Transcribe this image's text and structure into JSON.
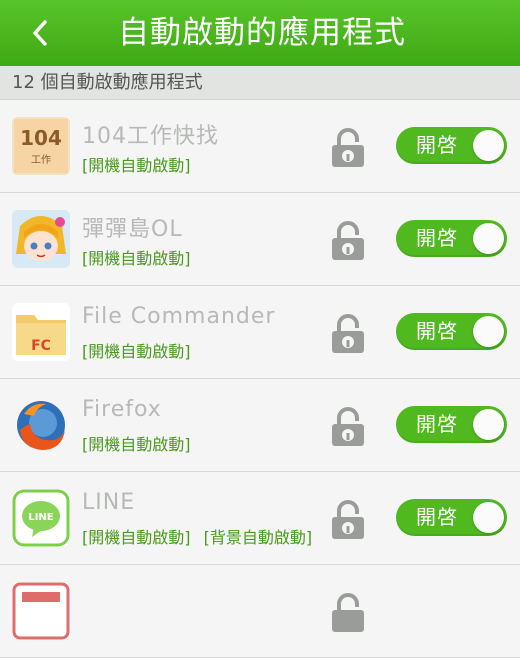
{
  "header": {
    "title": "自動啟動的應用程式",
    "back_icon": "chevron-left-icon"
  },
  "subheader": {
    "text": "12 個自動啟動應用程式"
  },
  "apps": [
    {
      "name": "104工作快找",
      "tags": [
        "[開機自動啟動]"
      ],
      "toggle": "開啓",
      "icon": "104-app-icon"
    },
    {
      "name": "彈彈島OL",
      "tags": [
        "[開機自動啟動]"
      ],
      "toggle": "開啓",
      "icon": "anime-game-icon"
    },
    {
      "name": "File Commander",
      "tags": [
        "[開機自動啟動]"
      ],
      "toggle": "開啓",
      "icon": "file-commander-icon"
    },
    {
      "name": "Firefox",
      "tags": [
        "[開機自動啟動]"
      ],
      "toggle": "開啓",
      "icon": "firefox-icon"
    },
    {
      "name": "LINE",
      "tags": [
        "[開機自動啟動]",
        "[背景自動啟動]"
      ],
      "toggle": "開啓",
      "icon": "line-icon"
    },
    {
      "name": "",
      "tags": [],
      "toggle": "",
      "icon": "app-icon"
    }
  ],
  "colors": {
    "accent": "#4fb91f",
    "header": "#46ae18",
    "tag": "#4b9a1d"
  }
}
